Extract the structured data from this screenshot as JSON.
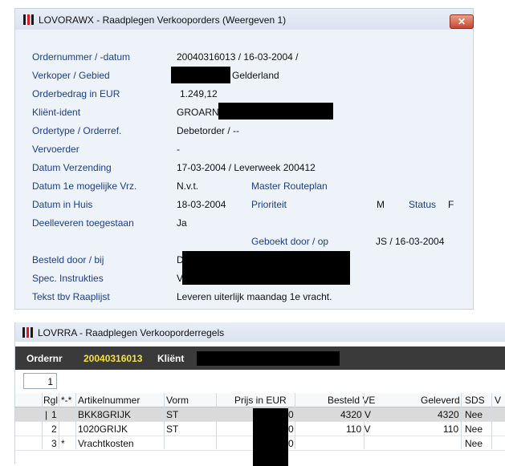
{
  "window1": {
    "title": "LOVORAWX - Raadplegen Verkooporders (Weergeven 1)",
    "close_symbol": "✕",
    "fields": {
      "ordernummer_label": "Ordernummer / -datum",
      "ordernummer_value": "20040316013 / 16-03-2004 /",
      "verkoper_label": "Verkoper / Gebied",
      "verkoper_value": "Gelderland",
      "orderbedrag_label": "Orderbedrag in EUR",
      "orderbedrag_value": "1.249,12",
      "klient_label": "Kliënt-ident",
      "klient_value": "GROARN",
      "ordertype_label": "Ordertype / Orderref.",
      "ordertype_value": "Debetorder / --",
      "vervoerder_label": "Vervoerder",
      "vervoerder_value": "-",
      "verzending_label": "Datum Verzending",
      "verzending_value": "17-03-2004 / Leverweek 200412",
      "datum1e_label": "Datum 1e mogelijke Vrz.",
      "datum1e_value": "N.v.t.",
      "routeplan_label": "Master Routeplan",
      "inhuis_label": "Datum in Huis",
      "inhuis_value": "18-03-2004",
      "prioriteit_label": "Prioriteit",
      "prioriteit_value": "M",
      "status_label": "Status",
      "status_value": "F",
      "deelleveren_label": "Deelleveren toegestaan",
      "deelleveren_value": "Ja",
      "geboekt_label": "Geboekt door / op",
      "geboekt_value": "JS / 16-03-2004",
      "besteld_label": "Besteld door / bij",
      "besteld_value": "D",
      "spec_label": "Spec. Instrukties",
      "spec_value": "V",
      "tekst_label": "Tekst tbv Raaplijst",
      "tekst_value": "Leveren uiterlijk maandag 1e vracht."
    }
  },
  "window2": {
    "title": "LOVRRA - Raadplegen Verkooporderregels",
    "ordernr_label": "Ordernr",
    "ordernr_value": "20040316013",
    "klient_label": "Kliënt",
    "page_value": "1",
    "columns": [
      "Rgl",
      "*-*",
      "Artikelnummer",
      "Vorm",
      "Prijs in EUR",
      "Besteld VE",
      "Geleverd",
      "SDS",
      "V"
    ],
    "rows": [
      {
        "marker": "|",
        "rgl": "1",
        "star": "",
        "artikel": "BKK8GRIJK",
        "vorm": "ST",
        "prijs_suffix": "0",
        "besteld": "4320 V",
        "geleverd": "4320",
        "sds": "Nee"
      },
      {
        "marker": "",
        "rgl": "2",
        "star": "",
        "artikel": "1020GRIJK",
        "vorm": "ST",
        "prijs_suffix": "0",
        "besteld": "110 V",
        "geleverd": "110",
        "sds": "Nee"
      },
      {
        "marker": "",
        "rgl": "3",
        "star": "*",
        "artikel": "Vrachtkosten",
        "vorm": "",
        "prijs_suffix": "0",
        "besteld": "",
        "geleverd": "",
        "sds": "Nee"
      }
    ]
  },
  "colors": {
    "label_blue": "#1c3d8c",
    "ordernr_yellow": "#f4e23a",
    "header_dark": "#3a3a3a"
  }
}
